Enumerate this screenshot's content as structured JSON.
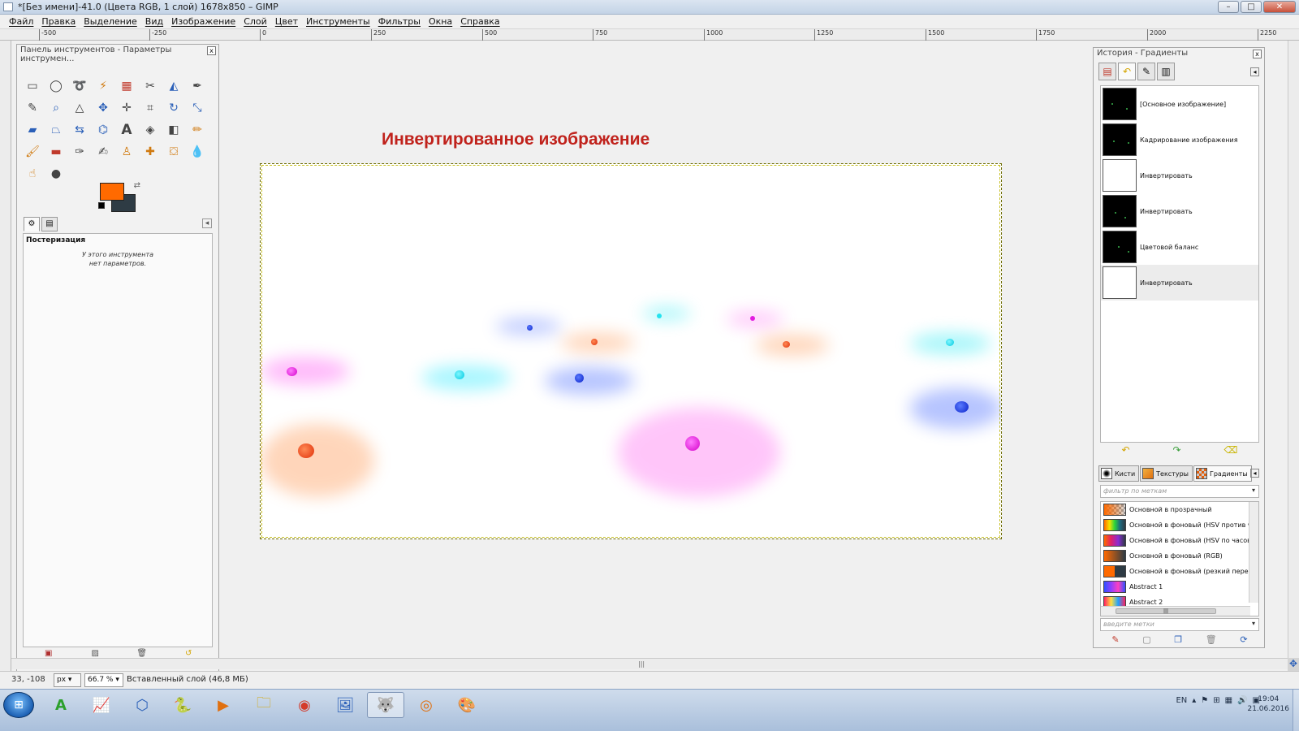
{
  "window": {
    "title": "*[Без имени]-41.0 (Цвета RGB, 1 слой) 1678x850 – GIMP",
    "buttons": [
      "–",
      "□",
      "✕"
    ]
  },
  "menubar": [
    "Файл",
    "Правка",
    "Выделение",
    "Вид",
    "Изображение",
    "Слой",
    "Цвет",
    "Инструменты",
    "Фильтры",
    "Окна",
    "Справка"
  ],
  "ruler": {
    "top_ticks": [
      "-500",
      "-250",
      "0",
      "250",
      "500",
      "750",
      "1000",
      "1250",
      "1500",
      "1750",
      "2000",
      "2250"
    ]
  },
  "toolbox": {
    "title": "Панель инструментов - Параметры инструмен...",
    "tools": [
      "rect-select-tool",
      "ellipse-select-tool",
      "free-select-tool",
      "fuzzy-select-tool",
      "select-by-color-tool",
      "scissors-tool",
      "foreground-select-tool",
      "paths-tool",
      "color-picker-tool",
      "zoom-tool",
      "measure-tool",
      "move-tool",
      "align-tool",
      "crop-tool",
      "rotate-tool",
      "scale-tool",
      "shear-tool",
      "perspective-tool",
      "flip-tool",
      "cage-tool",
      "text-tool",
      "bucket-fill-tool",
      "blend-tool",
      "pencil-tool",
      "paintbrush-tool",
      "eraser-tool",
      "airbrush-tool",
      "ink-tool",
      "clone-tool",
      "heal-tool",
      "perspective-clone-tool",
      "blur-sharpen-tool",
      "smudge-tool",
      "dodge-burn-tool"
    ],
    "fg_color": "#ff6a00",
    "bg_color": "#2e3b44",
    "options": {
      "title": "Постеризация",
      "note": "У этого инструмента\nнет параметров."
    }
  },
  "image": {
    "heading": "Инвертированное изображение",
    "heading_color": "#c0221c"
  },
  "history": {
    "dock_title": "История - Градиенты",
    "items": [
      {
        "label": "[Основное изображение]",
        "thumb": "dark"
      },
      {
        "label": "Кадрирование изображения",
        "thumb": "dark"
      },
      {
        "label": "Инвертировать",
        "thumb": "light"
      },
      {
        "label": "Инвертировать",
        "thumb": "dark"
      },
      {
        "label": "Цветовой баланс",
        "thumb": "dark"
      },
      {
        "label": "Инвертировать",
        "thumb": "light"
      }
    ]
  },
  "gradients": {
    "tabs": [
      "Кисти",
      "Текстуры",
      "Градиенты"
    ],
    "filter_placeholder": "фильтр по меткам",
    "tags_placeholder": "введите метки",
    "items": [
      {
        "name": "Основной в прозрачный"
      },
      {
        "name": "Основной в фоновый  (HSV против ча"
      },
      {
        "name": "Основной в фоновый (HSV по часово"
      },
      {
        "name": "Основной в фоновый (RGB)"
      },
      {
        "name": "Основной в фоновый (резкий перехо,"
      },
      {
        "name": "Abstract 1"
      },
      {
        "name": "Abstract 2"
      }
    ]
  },
  "status": {
    "coords": "33, -108",
    "unit": "px",
    "zoom": "66.7 %",
    "message": "Вставленный слой (46,8 МБ)"
  },
  "taskbar": {
    "lang": "EN",
    "time": "19:04",
    "date": "21.06.2016"
  }
}
